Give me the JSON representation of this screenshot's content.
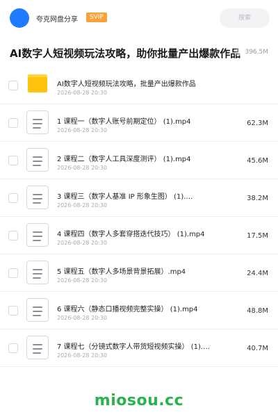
{
  "header": {
    "user_name": "夸克网盘分享",
    "badge": "SVIP",
    "search_placeholder": "搜索"
  },
  "page": {
    "title": "AI数字人短视频玩法攻略，助你批量产出爆款作品",
    "total_size": "396.5M"
  },
  "files": [
    {
      "type": "folder",
      "name": "AI数字人短视频玩法攻略，批量产出爆款作品",
      "date": "2026-08-28 20:30",
      "size": ""
    },
    {
      "type": "file",
      "name": "1 课程一（数字人账号前期定位） (1).mp4",
      "date": "2026-08-28 20:30",
      "size": "62.3M"
    },
    {
      "type": "file",
      "name": "2 课程二（数字人工具深度测评） (1).mp4",
      "date": "2026-08-28 20:30",
      "size": "45.6M"
    },
    {
      "type": "file",
      "name": "3 课程三（数字人基准 IP 形象生图） (1).…",
      "date": "2026-08-28 20:30",
      "size": "38.2M"
    },
    {
      "type": "file",
      "name": "4 课程四（数字人多套穿搭迭代技巧） (1).mp4",
      "date": "2026-08-28 20:30",
      "size": "17.5M"
    },
    {
      "type": "file",
      "name": "5 课程五（数字人多场景背景拓展）.mp4",
      "date": "2026-08-28 20:30",
      "size": "24.4M"
    },
    {
      "type": "file",
      "name": "6 课程六（静态口播视频完整实操） (1).mp4",
      "date": "2026-08-28 20:30",
      "size": "48.8M"
    },
    {
      "type": "file",
      "name": "7 课程七（分镜式数字人带货短视频实操） (1).…",
      "date": "2026-08-28 20:30",
      "size": "40.7M"
    }
  ],
  "watermark": "miosou.cc",
  "colors": {
    "accent": "#1f7bff",
    "svip": "#f7a23a",
    "folder": "#ffc20e",
    "watermark": "#2bb24c"
  },
  "icons": {
    "folder": "folder-icon",
    "file": "file-document-icon"
  }
}
